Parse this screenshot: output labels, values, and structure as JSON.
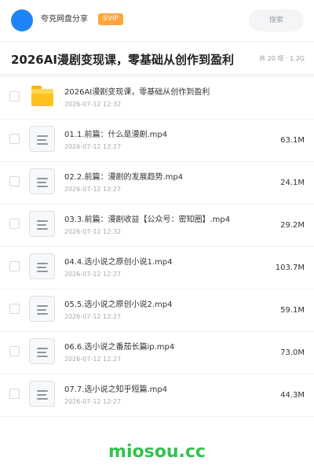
{
  "header": {
    "share_name": "夸克网盘分享",
    "badge": "SVIP",
    "search_label": "搜索",
    "brand_color": "#1f84f6",
    "badge_color": "#ffa53a"
  },
  "title": "2026AI漫剧变现课，零基础从创作到盈利",
  "meta": "共 20 项 · 1.2G",
  "items": [
    {
      "type": "folder",
      "name": "2026AI漫剧变现课，零基础从创作到盈利",
      "date": "2026-07-12 12:32",
      "size": ""
    },
    {
      "type": "file",
      "name": "01.1.前篇：什么是漫剧.mp4",
      "date": "2026-07-12 12:27",
      "size": "63.1M"
    },
    {
      "type": "file",
      "name": "02.2.前篇：漫剧的发展趋势.mp4",
      "date": "2026-07-12 12:27",
      "size": "24.1M"
    },
    {
      "type": "file",
      "name": "03.3.前篇：漫剧收益【公众号：密知圈】.mp4",
      "date": "2026-07-12 12:32",
      "size": "29.2M"
    },
    {
      "type": "file",
      "name": "04.4.选小说之原创小说1.mp4",
      "date": "2026-07-12 12:27",
      "size": "103.7M"
    },
    {
      "type": "file",
      "name": "05.5.选小说之原创小说2.mp4",
      "date": "2026-07-12 12:27",
      "size": "59.1M"
    },
    {
      "type": "file",
      "name": "06.6.选小说之番茄长篇ip.mp4",
      "date": "2026-07-12 12:27",
      "size": "73.0M"
    },
    {
      "type": "file",
      "name": "07.7.选小说之知乎短篇.mp4",
      "date": "2026-07-12 12:27",
      "size": "44.3M"
    }
  ],
  "footer": {
    "watermark": "miosou.cc",
    "color": "#33c24d"
  }
}
